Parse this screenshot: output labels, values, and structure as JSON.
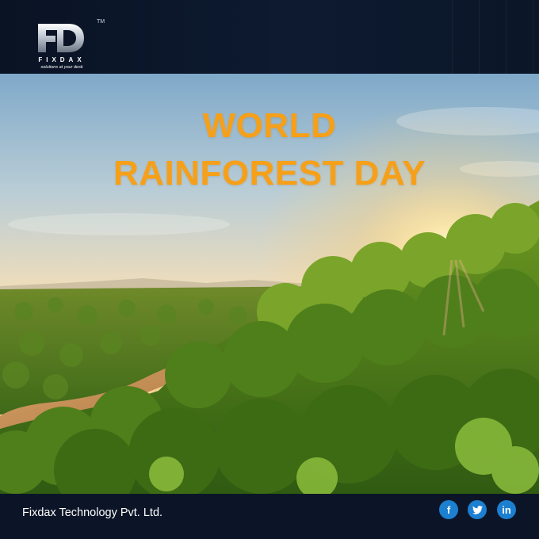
{
  "brand": {
    "name": "FIXDAX",
    "tagline": "solutions at your desk",
    "trademark": "TM",
    "logo_icon": "fd-monogram-logo"
  },
  "banner": {
    "title_line1": "WORLD",
    "title_line2": "RAINFOREST DAY",
    "title_color": "#f6a019"
  },
  "footer": {
    "company": "Fixdax Technology Pvt. Ltd.",
    "social": [
      {
        "icon": "facebook-icon",
        "glyph": "f"
      },
      {
        "icon": "twitter-icon",
        "glyph": ""
      },
      {
        "icon": "linkedin-icon",
        "glyph": "in"
      }
    ],
    "social_color": "#1c7fd0"
  }
}
